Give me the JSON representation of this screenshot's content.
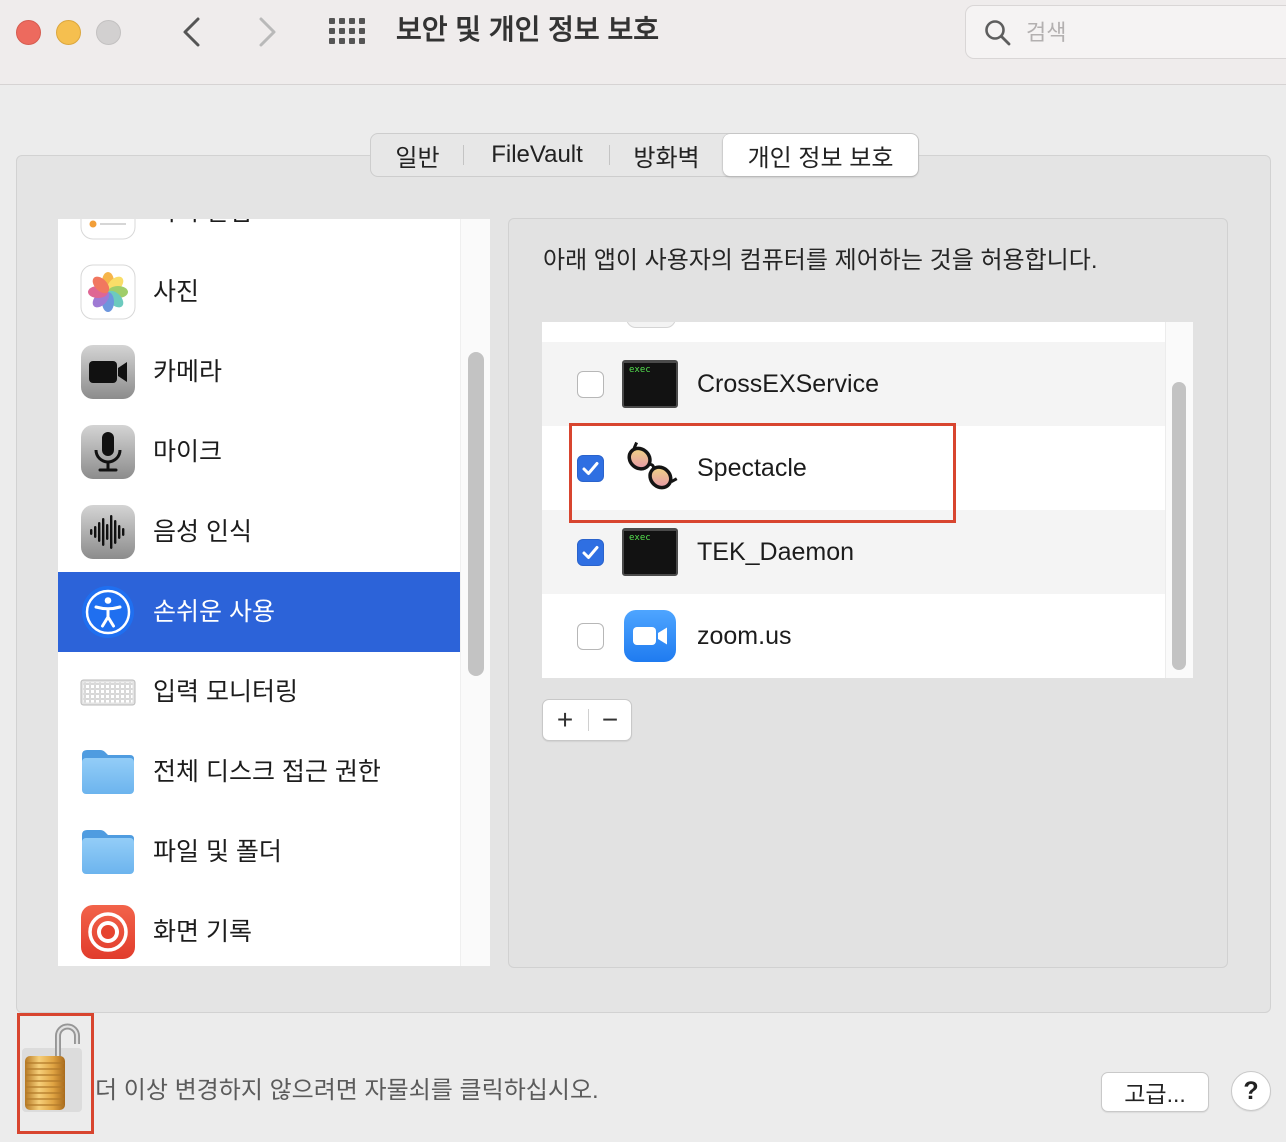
{
  "window": {
    "title": "보안 및 개인 정보 보호"
  },
  "toolbar": {
    "search_placeholder": "검색"
  },
  "tabs": [
    {
      "label": "일반",
      "selected": false
    },
    {
      "label": "FileVault",
      "selected": false
    },
    {
      "label": "방화벽",
      "selected": false
    },
    {
      "label": "개인 정보 보호",
      "selected": true
    }
  ],
  "sidebar": {
    "items": [
      {
        "label": "미리 알림",
        "icon": "reminders-icon",
        "selected": false
      },
      {
        "label": "사진",
        "icon": "photos-icon",
        "selected": false
      },
      {
        "label": "카메라",
        "icon": "camera-icon",
        "selected": false
      },
      {
        "label": "마이크",
        "icon": "microphone-icon",
        "selected": false
      },
      {
        "label": "음성 인식",
        "icon": "speech-recognition-icon",
        "selected": false
      },
      {
        "label": "손쉬운 사용",
        "icon": "accessibility-icon",
        "selected": true
      },
      {
        "label": "입력 모니터링",
        "icon": "keyboard-icon",
        "selected": false
      },
      {
        "label": "전체 디스크 접근 권한",
        "icon": "folder-icon",
        "selected": false
      },
      {
        "label": "파일 및 폴더",
        "icon": "folder-icon",
        "selected": false
      },
      {
        "label": "화면 기록",
        "icon": "screen-recording-icon",
        "selected": false
      }
    ]
  },
  "panel": {
    "description": "아래 앱이 사용자의 컴퓨터를 제어하는 것을 허용합니다.",
    "apps": [
      {
        "name": "CrossEXService",
        "checked": false,
        "icon": "exec-icon",
        "icon_text": "exec"
      },
      {
        "name": "Spectacle",
        "checked": true,
        "icon": "spectacle-icon"
      },
      {
        "name": "TEK_Daemon",
        "checked": true,
        "icon": "exec-icon",
        "icon_text": "exec"
      },
      {
        "name": "zoom.us",
        "checked": false,
        "icon": "zoom-icon"
      }
    ],
    "add_label": "+",
    "remove_label": "−"
  },
  "footer": {
    "lock_message": "더 이상 변경하지 않으려면 자물쇠를 클릭하십시오.",
    "advanced_label": "고급...",
    "help_label": "?"
  },
  "colors": {
    "accent": "#2c63d9",
    "checkbox_checked": "#2f6fe2",
    "highlight_box": "#d8452f"
  }
}
